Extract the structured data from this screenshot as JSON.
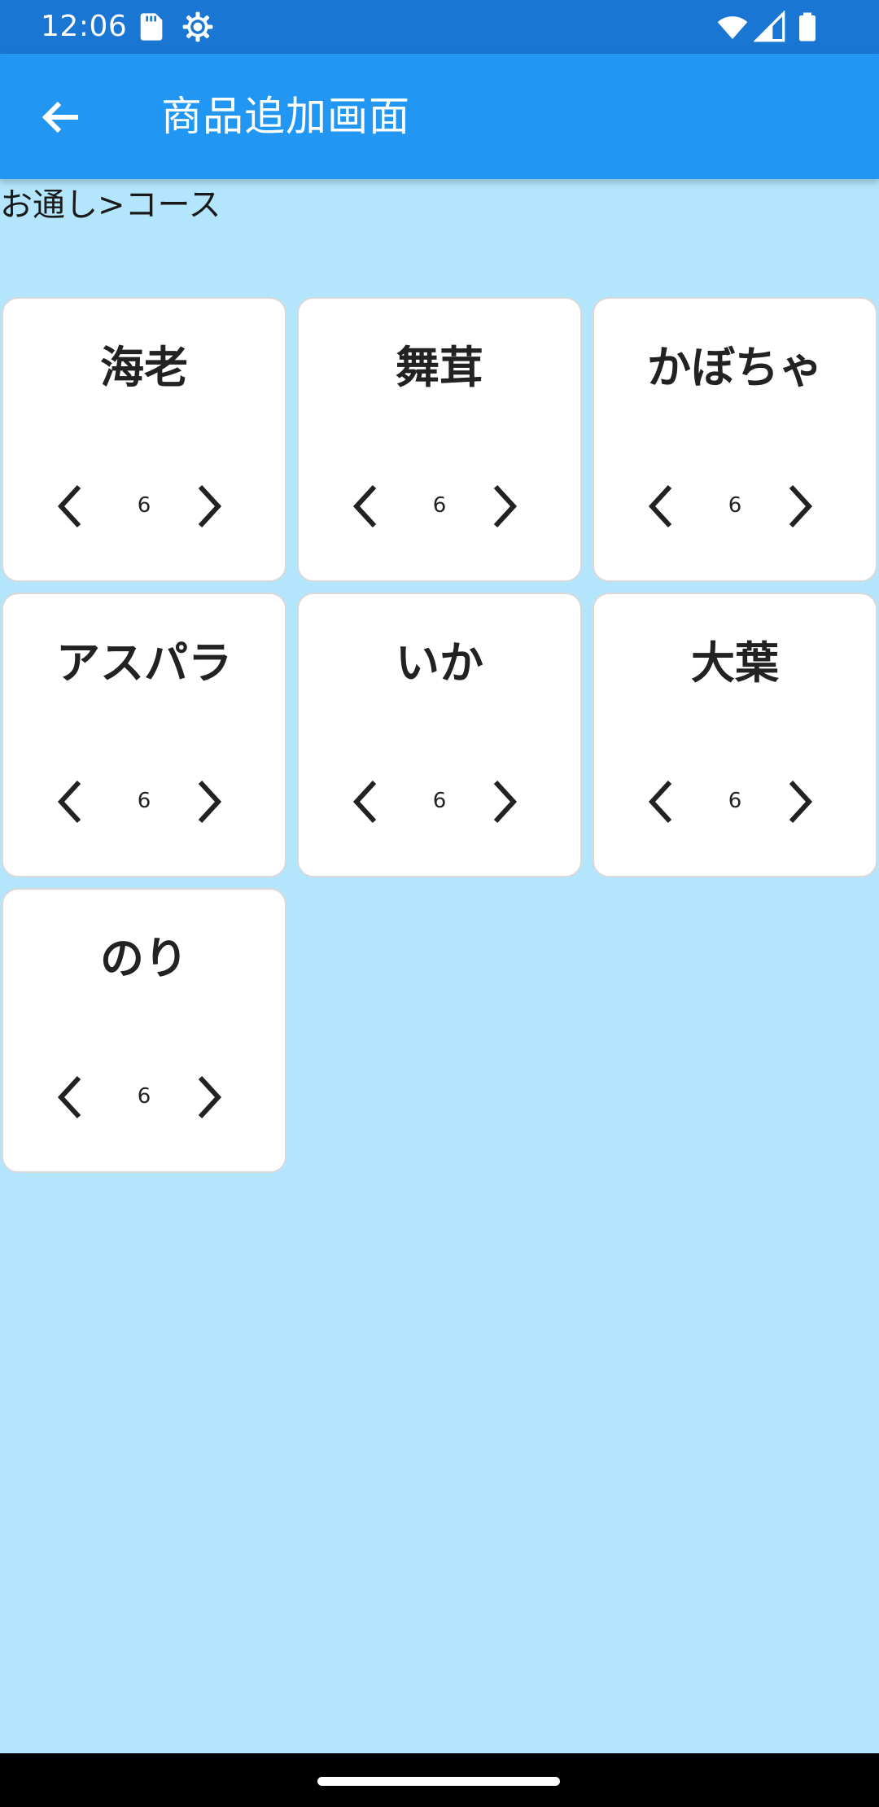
{
  "status_bar": {
    "time": "12:06",
    "icons": [
      "sd-card-icon",
      "settings-gear-icon",
      "wifi-icon",
      "cell-signal-icon",
      "battery-icon"
    ]
  },
  "app_bar": {
    "back_icon": "arrow-back-icon",
    "title": "商品追加画面"
  },
  "breadcrumb": "お通し>コース",
  "items": [
    {
      "name": "海老",
      "quantity": "6"
    },
    {
      "name": "舞茸",
      "quantity": "6"
    },
    {
      "name": "かぼちゃ",
      "quantity": "6"
    },
    {
      "name": "アスパラ",
      "quantity": "6"
    },
    {
      "name": "いか",
      "quantity": "6"
    },
    {
      "name": "大葉",
      "quantity": "6"
    },
    {
      "name": "のり",
      "quantity": "6"
    }
  ],
  "stepper_icons": {
    "decrement": "chevron-left-icon",
    "increment": "chevron-right-icon"
  },
  "colors": {
    "status_bar": "#1976d2",
    "app_bar": "#2196f3",
    "background": "#b3e5fc",
    "card": "#ffffff"
  }
}
